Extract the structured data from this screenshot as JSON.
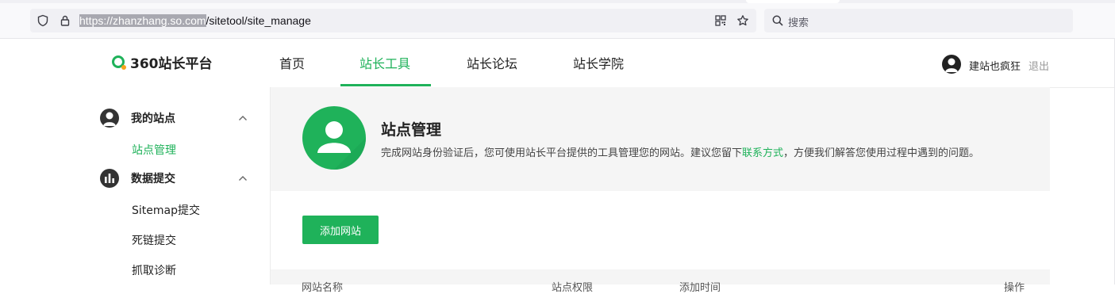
{
  "browser": {
    "url_host": "https://zhanzhang.so.com",
    "url_path": "/sitetool/site_manage",
    "search_placeholder": "搜索",
    "icons": [
      "shield-icon",
      "lock-icon",
      "qr-code-icon",
      "star-icon",
      "search-icon"
    ]
  },
  "header": {
    "logo_text": "360站长平台",
    "nav": [
      {
        "label": "首页",
        "active": false
      },
      {
        "label": "站长工具",
        "active": true
      },
      {
        "label": "站长论坛",
        "active": false
      },
      {
        "label": "站长学院",
        "active": false
      }
    ],
    "user_name": "建站也疯狂",
    "logout_label": "退出"
  },
  "sidebar": {
    "groups": [
      {
        "label": "我的站点",
        "icon": "user-icon",
        "items": [
          {
            "label": "站点管理",
            "active": true
          }
        ]
      },
      {
        "label": "数据提交",
        "icon": "bar-chart-icon",
        "items": [
          {
            "label": "Sitemap提交",
            "active": false
          },
          {
            "label": "死链提交",
            "active": false
          },
          {
            "label": "抓取诊断",
            "active": false
          }
        ]
      }
    ]
  },
  "main": {
    "title": "站点管理",
    "desc_prefix": "完成网站身份验证后，您可使用站长平台提供的工具管理您的网站。建议您留下",
    "desc_link": "联系方式",
    "desc_suffix": "，方便我们解答您使用过程中遇到的问题。",
    "add_button": "添加网站",
    "table_headers": [
      "网站名称",
      "站点权限",
      "添加时间",
      "操作"
    ]
  },
  "colors": {
    "accent": "#1fb25a",
    "text": "#222222",
    "muted": "#999999",
    "banner_bg": "#f5f5f5"
  }
}
